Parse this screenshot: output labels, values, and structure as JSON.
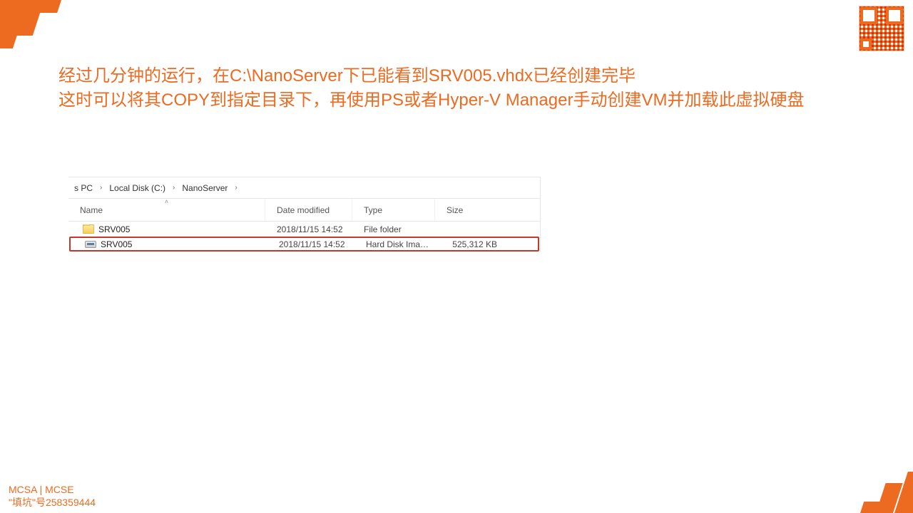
{
  "heading": {
    "line1": "经过几分钟的运行，在C:\\NanoServer下已能看到SRV005.vhdx已经创建完毕",
    "line2": "这时可以将其COPY到指定目录下，再使用PS或者Hyper-V Manager手动创建VM并加载此虚拟硬盘"
  },
  "explorer": {
    "breadcrumb": {
      "c0": "s PC",
      "c1": "Local Disk (C:)",
      "c2": "NanoServer"
    },
    "columns": {
      "name": "Name",
      "date": "Date modified",
      "type": "Type",
      "size": "Size"
    },
    "rows": [
      {
        "icon": "folder",
        "name": "SRV005",
        "date": "2018/11/15 14:52",
        "type": "File folder",
        "size": "",
        "highlight": false
      },
      {
        "icon": "vhd",
        "name": "SRV005",
        "date": "2018/11/15 14:52",
        "type": "Hard Disk Image F...",
        "size": "525,312 KB",
        "highlight": true
      }
    ]
  },
  "footer": {
    "line1": "MCSA | MCSE",
    "line2": "\"填坑\"号258359444"
  }
}
